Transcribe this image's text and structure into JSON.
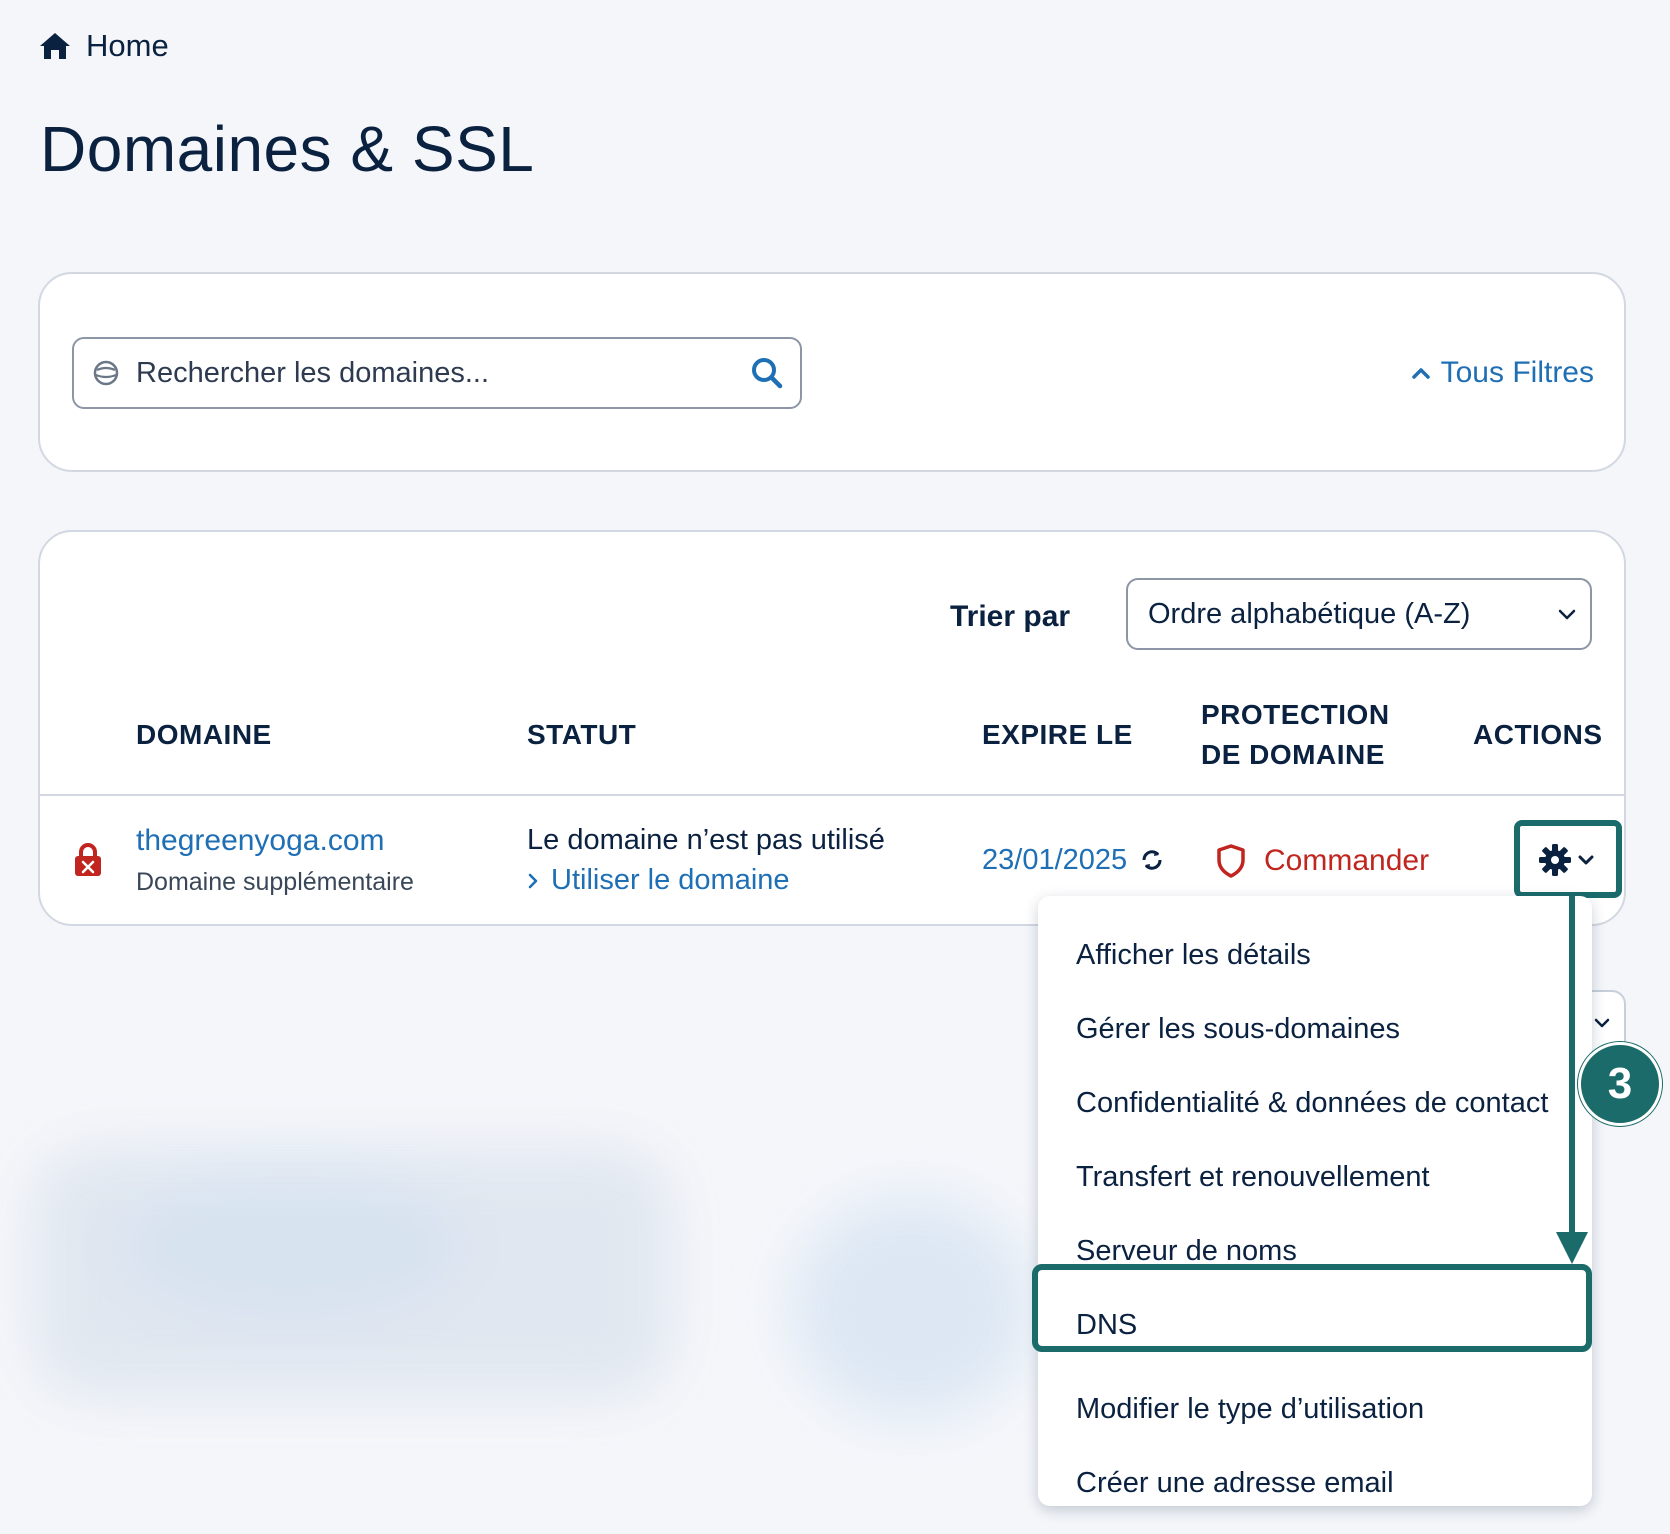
{
  "breadcrumb": {
    "label": "Home",
    "icon": "home-icon"
  },
  "page": {
    "title": "Domaines & SSL"
  },
  "search": {
    "placeholder": "Rechercher les domaines...",
    "icon": "search-icon"
  },
  "filters": {
    "label": "Tous Filtres",
    "icon": "chevron-up-icon"
  },
  "sort": {
    "label": "Trier par",
    "selected": "Ordre alphabétique (A-Z)"
  },
  "table": {
    "headers": {
      "domain": "DOMAINE",
      "status": "STATUT",
      "expires": "EXPIRE LE",
      "protection_line1": "PROTECTION",
      "protection_line2": "DE DOMAINE",
      "actions": "ACTIONS"
    },
    "rows": [
      {
        "domain": "thegreenyoga.com",
        "subtitle": "Domaine supplémentaire",
        "status": "Le domaine n’est pas utilisé",
        "status_action": "Utiliser le domaine",
        "expires": "23/01/2025",
        "protection_action": "Commander"
      }
    ]
  },
  "actions_menu": {
    "items": [
      "Afficher les détails",
      "Gérer les sous-domaines",
      "Confidentialité & données de contact",
      "Transfert et renouvellement",
      "Serveur de noms",
      "DNS",
      "Modifier le type d’utilisation",
      "Créer une adresse email"
    ],
    "highlighted": "DNS"
  },
  "annotation": {
    "step": "3"
  },
  "colors": {
    "link": "#1f6fb5",
    "danger": "#c0251f",
    "annotation": "#1b6b6b",
    "text": "#0b2140",
    "background": "#f4f6fa"
  }
}
